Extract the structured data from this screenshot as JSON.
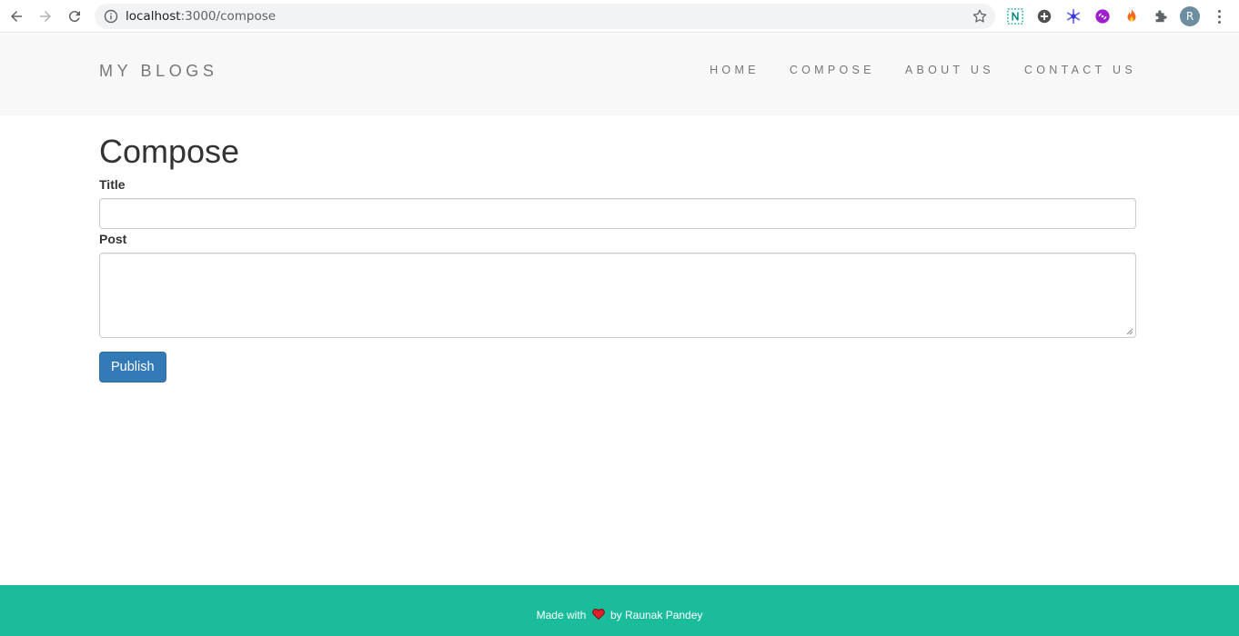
{
  "browser": {
    "url_host": "localhost",
    "url_path": ":3000/compose"
  },
  "navbar": {
    "brand": "MY BLOGS",
    "links": [
      "HOME",
      "COMPOSE",
      "ABOUT US",
      "CONTACT US"
    ]
  },
  "compose": {
    "heading": "Compose",
    "title_label": "Title",
    "title_value": "",
    "post_label": "Post",
    "post_value": "",
    "publish_label": "Publish"
  },
  "footer": {
    "prefix": "Made with",
    "suffix": "by Raunak Pandey"
  },
  "profile": {
    "initial": "R"
  },
  "colors": {
    "footer_bg": "#1abc9c",
    "button_bg": "#337ab7",
    "navbar_bg": "#f8f8f8"
  }
}
